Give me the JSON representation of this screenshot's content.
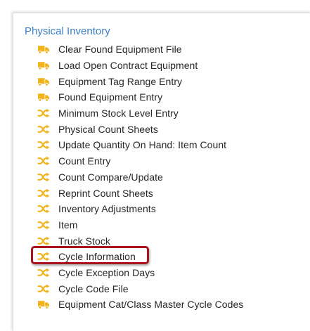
{
  "section": {
    "title": "Physical Inventory"
  },
  "colors": {
    "title": "#3d7fc2",
    "icon": "#f0b31c",
    "highlight": "#a8151c"
  },
  "items": [
    {
      "label": "Clear Found Equipment File",
      "icon": "truck-icon"
    },
    {
      "label": "Load Open Contract Equipment",
      "icon": "truck-icon"
    },
    {
      "label": "Equipment Tag Range Entry",
      "icon": "truck-icon"
    },
    {
      "label": "Found Equipment Entry",
      "icon": "truck-icon"
    },
    {
      "label": "Minimum Stock Level Entry",
      "icon": "shuffle-icon"
    },
    {
      "label": "Physical Count Sheets",
      "icon": "shuffle-icon"
    },
    {
      "label": "Update Quantity On Hand: Item Count",
      "icon": "shuffle-icon"
    },
    {
      "label": "Count Entry",
      "icon": "shuffle-icon"
    },
    {
      "label": "Count Compare/Update",
      "icon": "shuffle-icon"
    },
    {
      "label": "Reprint Count Sheets",
      "icon": "shuffle-icon"
    },
    {
      "label": "Inventory Adjustments",
      "icon": "shuffle-icon"
    },
    {
      "label": "Item",
      "icon": "shuffle-icon"
    },
    {
      "label": "Truck Stock",
      "icon": "shuffle-icon"
    },
    {
      "label": "Cycle Information",
      "icon": "shuffle-icon",
      "highlighted": true
    },
    {
      "label": "Cycle Exception Days",
      "icon": "shuffle-icon"
    },
    {
      "label": "Cycle Code File",
      "icon": "shuffle-icon"
    },
    {
      "label": "Equipment Cat/Class Master Cycle Codes",
      "icon": "truck-icon"
    }
  ]
}
